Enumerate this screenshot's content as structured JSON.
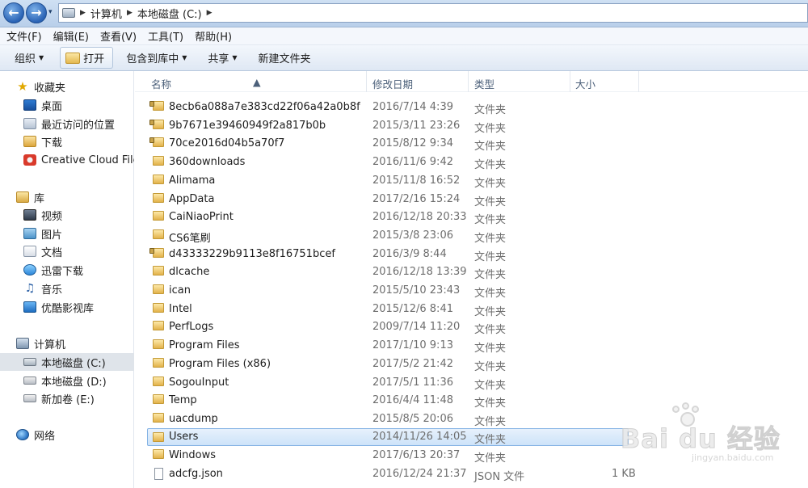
{
  "address": {
    "path": [
      "计算机",
      "本地磁盘 (C:)"
    ]
  },
  "menu": [
    "文件(F)",
    "编辑(E)",
    "查看(V)",
    "工具(T)",
    "帮助(H)"
  ],
  "toolbar": {
    "organize": "组织",
    "open": "打开",
    "include_library": "包含到库中",
    "share": "共享",
    "new_folder": "新建文件夹"
  },
  "sidebar": {
    "favorites": {
      "title": "收藏夹",
      "items": [
        "桌面",
        "最近访问的位置",
        "下载",
        "Creative Cloud Files"
      ]
    },
    "libraries": {
      "title": "库",
      "items": [
        "视频",
        "图片",
        "文档",
        "迅雷下载",
        "音乐",
        "优酷影视库"
      ]
    },
    "computer": {
      "title": "计算机",
      "items": [
        "本地磁盘 (C:)",
        "本地磁盘 (D:)",
        "新加卷 (E:)"
      ]
    },
    "network": {
      "title": "网络"
    }
  },
  "columns": {
    "name": "名称",
    "date": "修改日期",
    "type": "类型",
    "size": "大小"
  },
  "files": [
    {
      "name": "8ecb6a088a7e383cd22f06a42a0b8f",
      "date": "2016/7/14 4:39",
      "type": "文件夹",
      "size": "",
      "locked": true
    },
    {
      "name": "9b7671e39460949f2a817b0b",
      "date": "2015/3/11 23:26",
      "type": "文件夹",
      "size": "",
      "locked": true
    },
    {
      "name": "70ce2016d04b5a70f7",
      "date": "2015/8/12 9:34",
      "type": "文件夹",
      "size": "",
      "locked": true
    },
    {
      "name": "360downloads",
      "date": "2016/11/6 9:42",
      "type": "文件夹",
      "size": ""
    },
    {
      "name": "Alimama",
      "date": "2015/11/8 16:52",
      "type": "文件夹",
      "size": ""
    },
    {
      "name": "AppData",
      "date": "2017/2/16 15:24",
      "type": "文件夹",
      "size": ""
    },
    {
      "name": "CaiNiaoPrint",
      "date": "2016/12/18 20:33",
      "type": "文件夹",
      "size": ""
    },
    {
      "name": "CS6笔刷",
      "date": "2015/3/8 23:06",
      "type": "文件夹",
      "size": ""
    },
    {
      "name": "d43333229b9113e8f16751bcef",
      "date": "2016/3/9 8:44",
      "type": "文件夹",
      "size": "",
      "locked": true
    },
    {
      "name": "dlcache",
      "date": "2016/12/18 13:39",
      "type": "文件夹",
      "size": ""
    },
    {
      "name": "ican",
      "date": "2015/5/10 23:43",
      "type": "文件夹",
      "size": ""
    },
    {
      "name": "Intel",
      "date": "2015/12/6 8:41",
      "type": "文件夹",
      "size": ""
    },
    {
      "name": "PerfLogs",
      "date": "2009/7/14 11:20",
      "type": "文件夹",
      "size": ""
    },
    {
      "name": "Program Files",
      "date": "2017/1/10 9:13",
      "type": "文件夹",
      "size": ""
    },
    {
      "name": "Program Files (x86)",
      "date": "2017/5/2 21:42",
      "type": "文件夹",
      "size": ""
    },
    {
      "name": "SogouInput",
      "date": "2017/5/1 11:36",
      "type": "文件夹",
      "size": ""
    },
    {
      "name": "Temp",
      "date": "2016/4/4 11:48",
      "type": "文件夹",
      "size": ""
    },
    {
      "name": "uacdump",
      "date": "2015/8/5 20:06",
      "type": "文件夹",
      "size": ""
    },
    {
      "name": "Users",
      "date": "2014/11/26 14:05",
      "type": "文件夹",
      "size": "",
      "selected": true
    },
    {
      "name": "Windows",
      "date": "2017/6/13 20:37",
      "type": "文件夹",
      "size": ""
    },
    {
      "name": "adcfg.json",
      "date": "2016/12/24 21:37",
      "type": "JSON 文件",
      "size": "1 KB",
      "file": true
    }
  ],
  "watermark": {
    "text": "Bai du 经验",
    "url": "jingyan.baidu.com"
  }
}
